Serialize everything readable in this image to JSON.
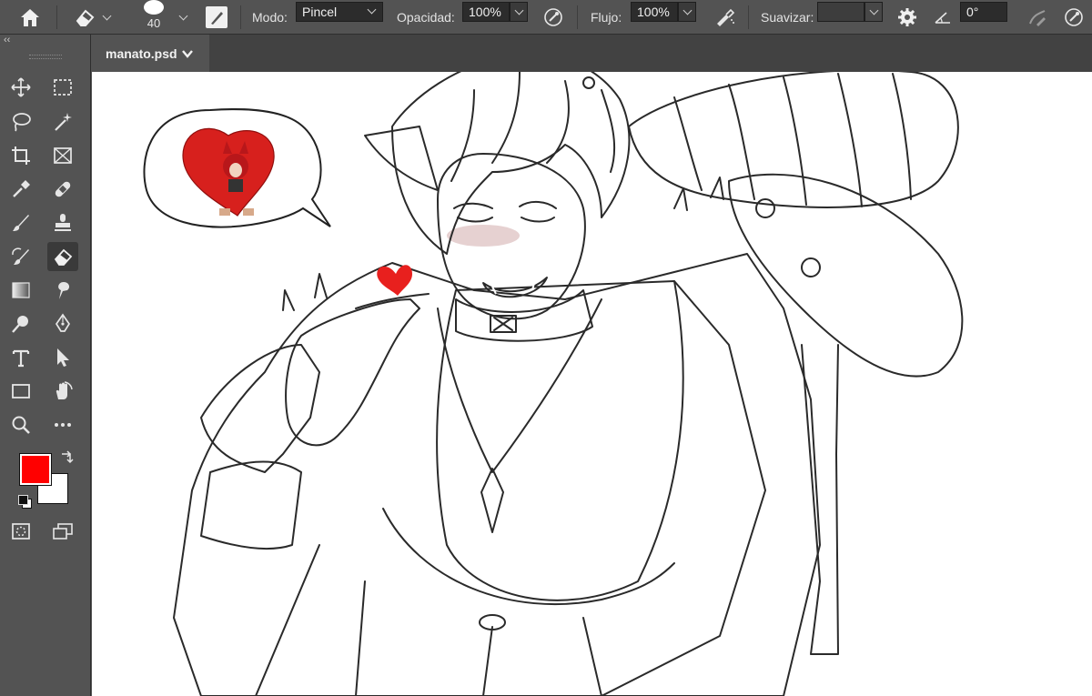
{
  "options_bar": {
    "brush_size": "40",
    "mode_label": "Modo:",
    "mode_value": "Pincel",
    "opacity_label": "Opacidad:",
    "opacity_value": "100%",
    "flow_label": "Flujo:",
    "flow_value": "100%",
    "smoothing_label": "Suavizar:",
    "smoothing_value": "",
    "angle_value": "0°"
  },
  "document": {
    "tab_title": "manato.psd"
  },
  "toolbar": {
    "collapse_glyph": "‹‹",
    "foreground_color": "#ff0000",
    "background_color": "#ffffff"
  },
  "colors": {
    "ui_panel": "#535353",
    "ui_dark": "#424242",
    "heart": "#e8201e"
  }
}
